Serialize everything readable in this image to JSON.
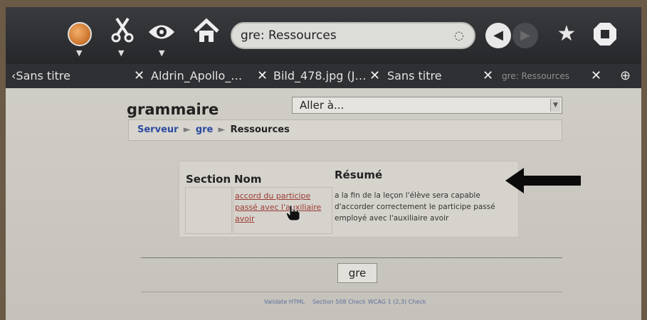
{
  "toolbar": {
    "url_text": "gre: Ressources",
    "icons": [
      "globe-icon",
      "scissors-icon",
      "eye-icon",
      "home-icon",
      "reload-icon",
      "back-icon",
      "forward-icon",
      "star-icon",
      "stop-icon"
    ]
  },
  "tabs": [
    {
      "label": "Sans titre",
      "prefix": "‹"
    },
    {
      "label": "Aldrin_Apollo_…"
    },
    {
      "label": "Bild_478.jpg (J…"
    },
    {
      "label": "Sans titre"
    },
    {
      "label": "gre: Ressources",
      "active": true
    }
  ],
  "page": {
    "title": "grammaire",
    "goto_label": "Aller à...",
    "breadcrumb": {
      "items": [
        "Serveur",
        "gre",
        "Ressources"
      ],
      "separator": "►"
    },
    "table": {
      "headers": [
        "Section",
        "Nom",
        "Résumé"
      ],
      "rows": [
        {
          "section": "",
          "name": "accord du participe passé avec l'auxiliaire avoir",
          "name_lines": [
            "accord du participe",
            "passé avec l'auxiliaire",
            "avoir"
          ],
          "summary_lines": [
            "a la fin de la leçon l'élève sera capable",
            "d'accorder correctement le participe passé",
            "employé avec l'auxiliaire avoir"
          ]
        }
      ]
    },
    "button_label": "gre",
    "footer_links": [
      "Validate HTML",
      "Section 508 Check",
      "WCAG 1 (2,3) Check"
    ]
  },
  "colors": {
    "toolbar_bg": "#2a2b2e",
    "link": "#2d4aa0",
    "resource_link": "#9c3a33",
    "page_bg": "#c9c7bf"
  }
}
